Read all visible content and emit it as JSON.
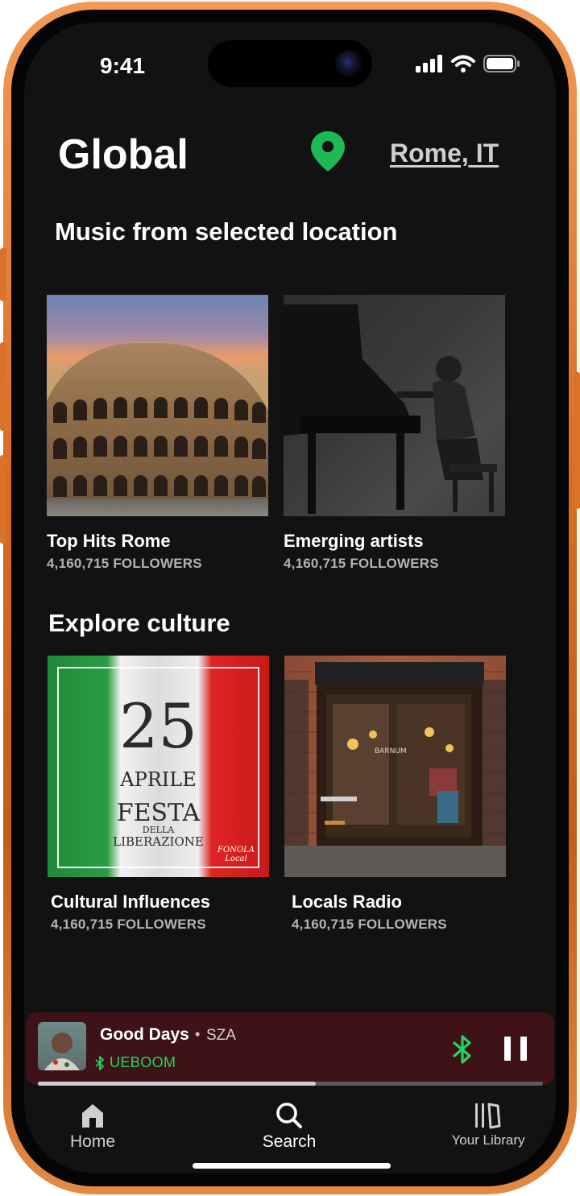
{
  "status_bar": {
    "time": "9:41"
  },
  "header": {
    "title": "Global",
    "location": "Rome, IT"
  },
  "sections": [
    {
      "title": "Music from selected location",
      "cards": [
        {
          "title": "Top Hits Rome",
          "followers": "4,160,715 FOLLOWERS",
          "art": "colosseum-photo"
        },
        {
          "title": "Emerging artists",
          "followers": "4,160,715 FOLLOWERS",
          "art": "pianist-photo"
        }
      ]
    },
    {
      "title": "Explore culture",
      "cards": [
        {
          "title": "Cultural Influences",
          "followers": "4,160,715 FOLLOWERS",
          "art": "italian-flag-poster"
        },
        {
          "title": "Locals Radio",
          "followers": "4,160,715 FOLLOWERS",
          "art": "storefront-photo"
        }
      ]
    }
  ],
  "poster": {
    "line1": "25",
    "line2": "APRILE",
    "line3": "FESTA",
    "line4": "DELLA",
    "line5": "LIBERAZIONE",
    "logo": "FONOLA Local"
  },
  "store_sign": "BARNUM",
  "now_playing": {
    "title": "Good Days",
    "separator": "•",
    "artist": "SZA",
    "device": "UEBOOM",
    "progress": 0.55,
    "accent_color": "#1ed760",
    "background_color": "#3f1217"
  },
  "nav": [
    {
      "label": "Home",
      "icon": "home-icon"
    },
    {
      "label": "Search",
      "icon": "search-icon"
    },
    {
      "label": "Your Library",
      "icon": "library-icon"
    }
  ],
  "colors": {
    "pin": "#1db954",
    "screen_bg": "#121212",
    "frame": "#e0762c"
  }
}
